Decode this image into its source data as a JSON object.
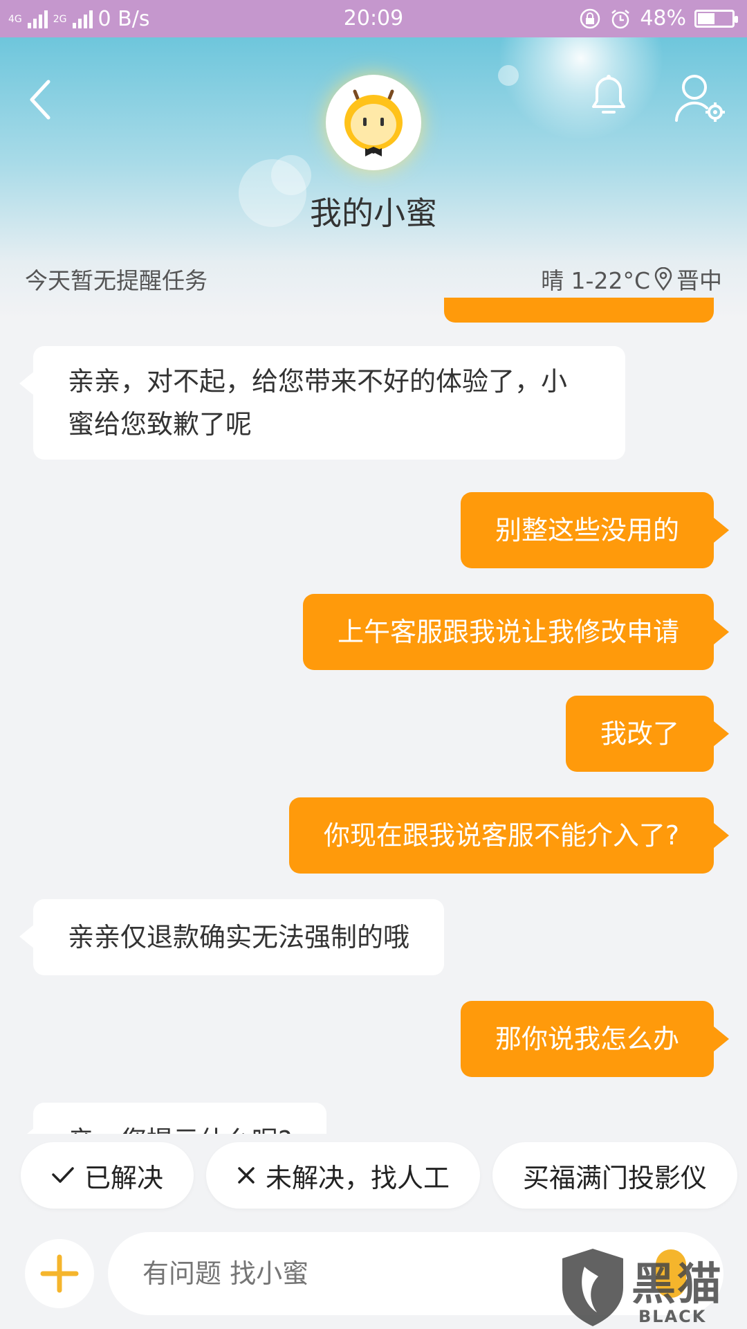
{
  "status_bar": {
    "net_4g": "4G",
    "net_2g": "2G",
    "speed": "0 B/s",
    "time": "20:09",
    "battery": "48%",
    "battery_level": 0.48
  },
  "header": {
    "title": "我的小蜜",
    "reminder": "今天暂无提醒任务",
    "weather": "晴 1-22°C",
    "location": "晋中"
  },
  "messages": [
    {
      "from": "bot",
      "text": "亲亲，对不起，给您带来不好的体验了，小蜜给您致歉了呢"
    },
    {
      "from": "user",
      "text": "别整这些没用的"
    },
    {
      "from": "user",
      "text": "上午客服跟我说让我修改申请"
    },
    {
      "from": "user",
      "text": "我改了"
    },
    {
      "from": "user",
      "text": "你现在跟我说客服不能介入了?"
    },
    {
      "from": "bot",
      "text": "亲亲仅退款确实无法强制的哦"
    },
    {
      "from": "user",
      "text": "那你说我怎么办"
    },
    {
      "from": "bot",
      "text": "亲，您提示什么呢?"
    }
  ],
  "quick_replies": [
    "已解决",
    "未解决，找人工",
    "买福满门投影仪"
  ],
  "input": {
    "placeholder": "有问题 找小蜜"
  },
  "watermark": {
    "text": "黑猫",
    "sub": "BLACK CAT"
  },
  "colors": {
    "accent": "#ff9a0b",
    "status_bar": "#c597cd",
    "header_sky": "#6ec6dc"
  }
}
